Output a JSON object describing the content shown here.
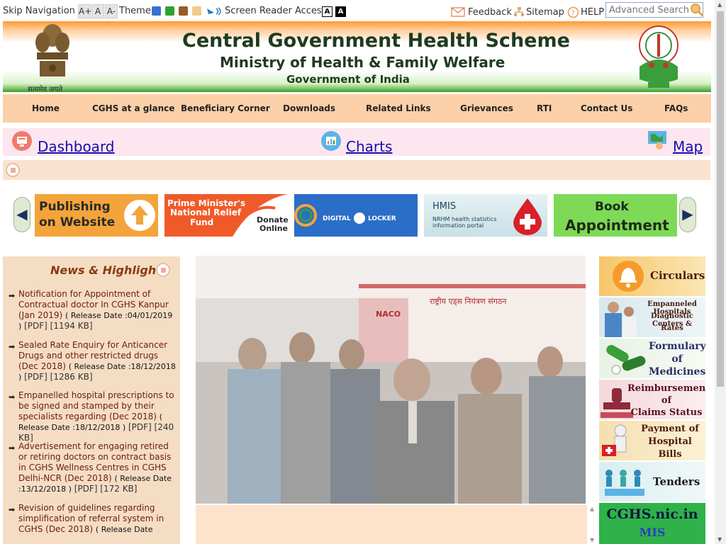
{
  "topbar": {
    "skip_nav": "Skip Navigation",
    "font_larger": "A+",
    "font_normal": "A",
    "font_smaller": "A-",
    "theme_label": "Theme",
    "screen_reader": "Screen Reader Access",
    "contrast_1": "A",
    "contrast_2": "A",
    "feedback": "Feedback",
    "sitemap": "Sitemap",
    "help": "HELP",
    "search_placeholder": "Advanced Search",
    "theme_colors": [
      "#3b6fd4",
      "#2fa12f",
      "#9a5a24",
      "#f3c98c"
    ]
  },
  "banner": {
    "line1": "Central Government Health Scheme",
    "line2": "Ministry of Health & Family Welfare",
    "line3": "Government of India",
    "emblem_caption": "सत्यमेव जयते"
  },
  "nav": {
    "items": [
      "Home",
      "CGHS at a glance",
      "Beneficiary Corner",
      "Downloads",
      "Related Links",
      "Grievances",
      "RTI",
      "Contact Us",
      "FAQs"
    ]
  },
  "quick_links": {
    "dashboard": "Dashboard",
    "charts": "Charts",
    "map": "Map"
  },
  "carousel": {
    "tiles": [
      {
        "line1": "Publishing",
        "line2": "on Website"
      },
      {
        "line1": "Prime Minister's",
        "line2": "National Relief",
        "line3": "Fund",
        "cta1": "Donate",
        "cta2": "Online"
      },
      {
        "line1": "DIGITAL",
        "line2": "LOCKER"
      },
      {
        "line1": "HMIS",
        "line2": "NRHM health statistics",
        "line3": "information portal"
      },
      {
        "line1": "Book",
        "line2": "Appointment"
      }
    ]
  },
  "news": {
    "title": "News & Highlights",
    "items": [
      {
        "title": "Notification for Appointment of Contractual doctor In CGHS Kanpur (Jan 2019)",
        "date": "( Release Date :04/01/2019 )",
        "file": "[PDF] [1194 KB]"
      },
      {
        "title": "Sealed Rate Enquiry for Anticancer Drugs and other restricted drugs (Dec 2018)",
        "date": "( Release Date :18/12/2018 )",
        "file": "[PDF] [1286 KB]"
      },
      {
        "title": "Empanelled hospital prescriptions to be signed and stamped by their specialists regarding (Dec 2018)",
        "date": "( Release Date :18/12/2018 )",
        "file": "[PDF] [240 KB]"
      },
      {
        "title": "Advertisement for engaging retired or retiring doctors on contract basis in CGHS Wellness Centres in CGHS Delhi-NCR (Dec 2018)",
        "date": "( Release Date :13/12/2018 )",
        "file": "[PDF] [172 KB]"
      },
      {
        "title": "Revision of guidelines regarding simplification of referral system in CGHS (Dec 2018)",
        "date": "( Release Date",
        "file": ""
      }
    ]
  },
  "photo": {
    "sign_text": "राष्ट्रीय एड्स नियंत्रण संगठन",
    "sign_logo": "NACO"
  },
  "right_tiles": [
    {
      "lines": [
        "Circulars"
      ]
    },
    {
      "lines": [
        "Empanneled Hospitals",
        "Diagnostic Centers &",
        "Rates"
      ]
    },
    {
      "lines": [
        "Formulary",
        "of",
        "Medicines"
      ]
    },
    {
      "lines": [
        "Reimbursement",
        "of",
        "Claims Status"
      ]
    },
    {
      "lines": [
        "Payment of",
        "Hospital",
        "Bills"
      ]
    },
    {
      "lines": [
        "Tenders"
      ]
    },
    {
      "lines": [
        "CGHS.nic.in",
        "MIS"
      ]
    }
  ]
}
